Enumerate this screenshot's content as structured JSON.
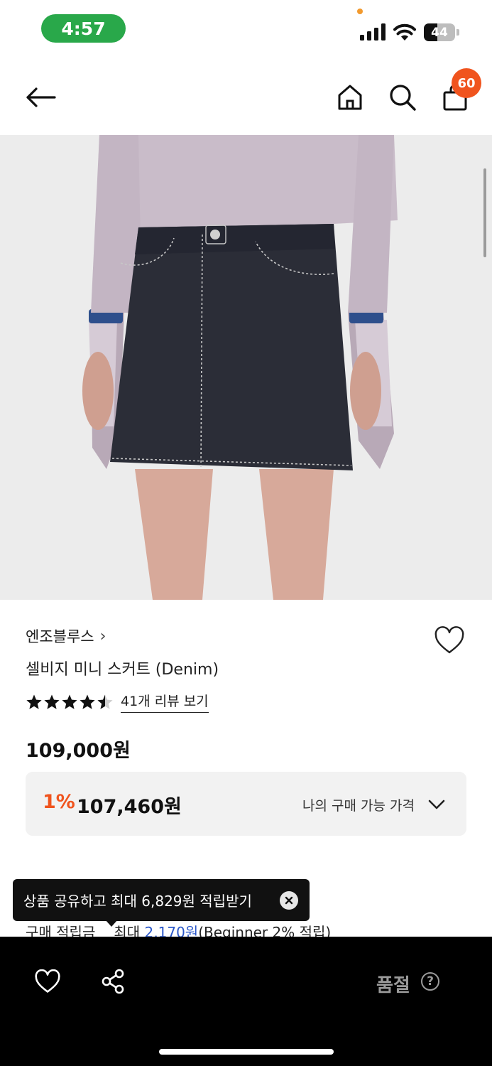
{
  "status_bar": {
    "time": "4:57",
    "battery_level": "44",
    "battery_fraction": 0.44,
    "time_pill_color": "#29a84a"
  },
  "nav": {
    "back_icon": "arrow-left-icon",
    "home_icon": "home-icon",
    "search_icon": "search-icon",
    "cart_icon": "shopping-bag-icon",
    "cart_count": "60",
    "badge_color": "#f0541e"
  },
  "product": {
    "brand": "엔조블루스",
    "brand_chevron": "›",
    "name": "셀비지 미니 스커트 (Denim)",
    "rating": 4.5,
    "rating_max": 5,
    "review_link": "41개 리뷰 보기",
    "price": "109,000원"
  },
  "my_price": {
    "discount_rate": "1%",
    "discount_price": "107,460원",
    "label": "나의 구매 가능 가격",
    "accent_color": "#f0541e"
  },
  "tooltip": {
    "text": "상품 공유하고 최대 6,829원 적립받기",
    "close_icon": "close-icon"
  },
  "points": {
    "label": "구매 적립금",
    "prefix": "최대 ",
    "amount": "2,170원",
    "suffix": "(Beginner 2% 적립)",
    "amount_color": "#2a57c9"
  },
  "bottom_bar": {
    "wishlist_icon": "heart-icon",
    "share_icon": "share-icon",
    "status": "품절",
    "help_icon": "question-icon"
  }
}
